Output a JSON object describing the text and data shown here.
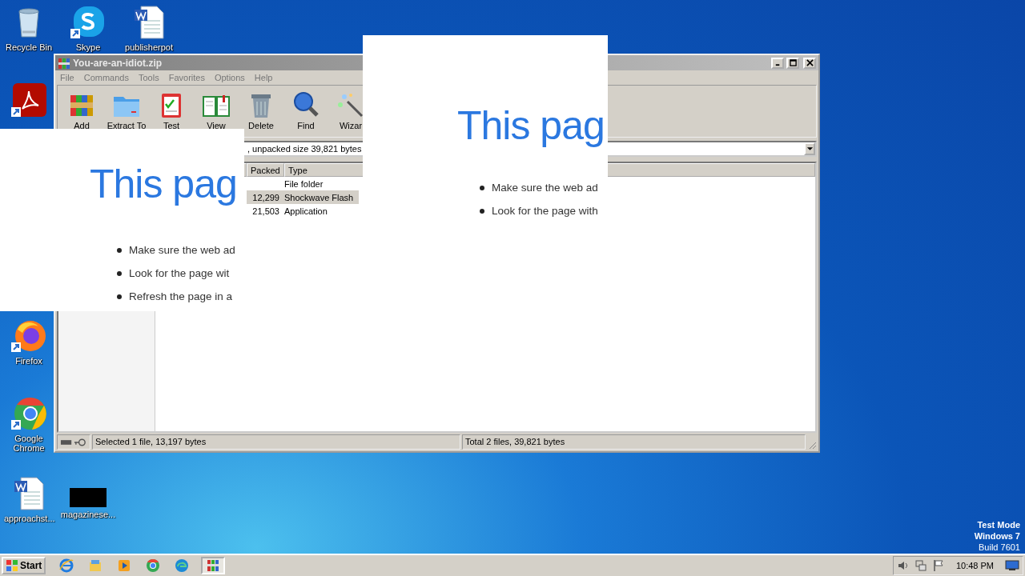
{
  "desktop_icons": [
    {
      "label": "Recycle Bin",
      "kind": "recycle"
    },
    {
      "label": "Skype",
      "kind": "skype"
    },
    {
      "label": "publisherpot",
      "kind": "word"
    },
    {
      "kind": "acrobat"
    },
    {
      "label": "Firefox",
      "kind": "firefox"
    },
    {
      "label": "Google Chrome",
      "kind": "chrome"
    },
    {
      "label": "approachst...",
      "kind": "word"
    },
    {
      "label": "magazinese...",
      "kind": "black"
    }
  ],
  "winrar_window": {
    "title": "You-are-an-idiot.zip",
    "menu": [
      "File",
      "Commands",
      "Tools",
      "Favorites",
      "Options",
      "Help"
    ],
    "toolbar": [
      {
        "label": "Add",
        "kind": "add"
      },
      {
        "label": "Extract To",
        "kind": "extract"
      },
      {
        "label": "Test",
        "kind": "test"
      },
      {
        "label": "View",
        "kind": "view"
      },
      {
        "label": "Delete",
        "kind": "delete"
      },
      {
        "label": "Find",
        "kind": "find"
      },
      {
        "label": "Wizar",
        "kind": "wizard"
      }
    ],
    "path_text": ", unpacked size 39,821 bytes",
    "columns": [
      "Packed",
      "Type"
    ],
    "rows": [
      {
        "packed": "",
        "type": "File folder",
        "selected": false
      },
      {
        "packed": "12,299",
        "type": "Shockwave Flash",
        "selected": true
      },
      {
        "packed": "21,503",
        "type": "Application",
        "selected": false
      }
    ],
    "status_left": "Selected 1 file, 13,197 bytes",
    "status_right": "Total 2 files, 39,821 bytes"
  },
  "browser_popups": [
    {
      "heading": "This pag",
      "bullets": [
        "Make sure the web ad",
        "Look for the page wit",
        "Refresh the page in a"
      ]
    },
    {
      "heading": "This pag",
      "bullets": [
        "Make sure the web ad",
        "Look for the page with"
      ]
    }
  ],
  "taskbar": {
    "start": "Start",
    "apps": [
      {
        "kind": "ie",
        "selected": false
      },
      {
        "kind": "explorer",
        "selected": false
      },
      {
        "kind": "media",
        "selected": false
      },
      {
        "kind": "chrome",
        "selected": false
      },
      {
        "kind": "edge",
        "selected": false
      },
      {
        "kind": "winrar",
        "selected": true
      }
    ],
    "clock": "10:48 PM"
  },
  "os_notice": [
    {
      "text": "Test Mode",
      "bold": true
    },
    {
      "text": "Windows 7",
      "bold": true
    },
    {
      "text": "Build 7601",
      "bold": false
    }
  ]
}
